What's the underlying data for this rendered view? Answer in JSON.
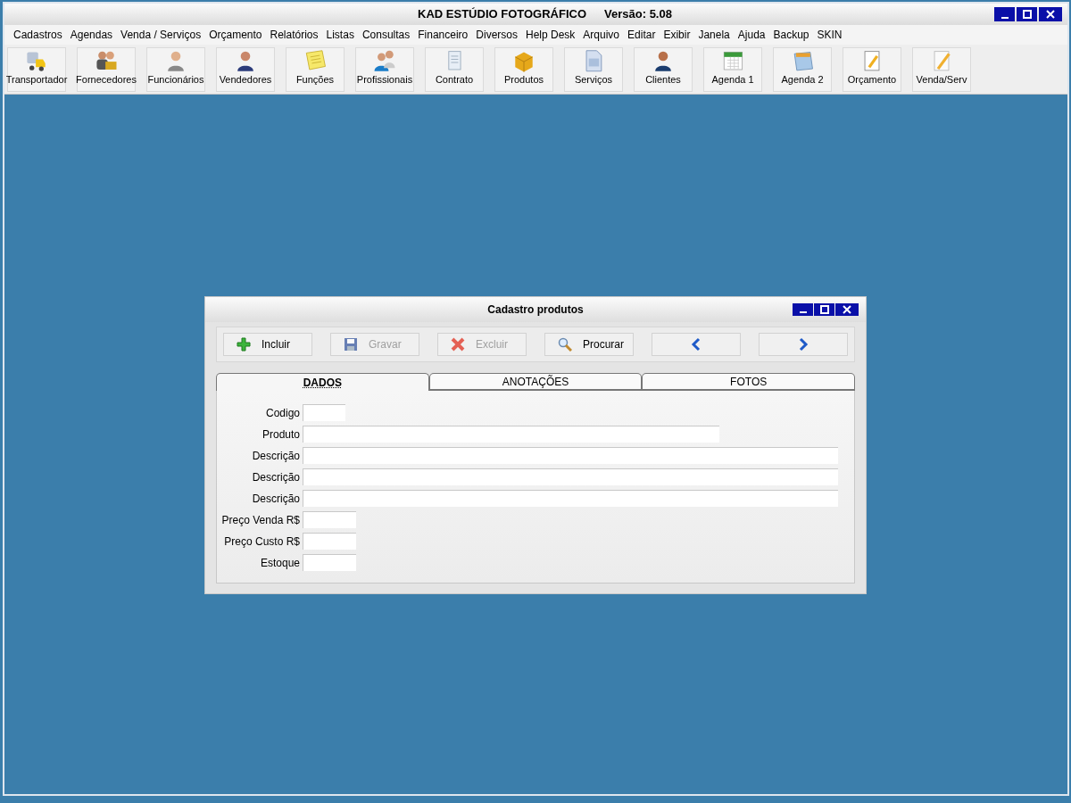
{
  "window": {
    "title": "KAD ESTÚDIO FOTOGRÁFICO",
    "version": "Versão: 5.08"
  },
  "menu": [
    "Cadastros",
    "Agendas",
    "Venda / Serviços",
    "Orçamento",
    "Relatórios",
    "Listas",
    "Consultas",
    "Financeiro",
    "Diversos",
    "Help Desk",
    "Arquivo",
    "Editar",
    "Exibir",
    "Janela",
    "Ajuda",
    "Backup",
    "SKIN"
  ],
  "toolbar": [
    "Transportador",
    "Fornecedores",
    "Funcionários",
    "Vendedores",
    "Funções",
    "Profissionais",
    "Contrato",
    "Produtos",
    "Serviços",
    "Clientes",
    "Agenda 1",
    "Agenda 2",
    "Orçamento",
    "Venda/Serv"
  ],
  "dialog": {
    "title": "Cadastro produtos",
    "actions": [
      {
        "kind": "add",
        "label": "Incluir",
        "disabled": false
      },
      {
        "kind": "save",
        "label": "Gravar",
        "disabled": true
      },
      {
        "kind": "delete",
        "label": "Excluir",
        "disabled": true
      },
      {
        "kind": "search",
        "label": "Procurar",
        "disabled": false
      },
      {
        "kind": "prev",
        "disabled": false
      },
      {
        "kind": "next",
        "disabled": false
      }
    ],
    "tabs": [
      {
        "label": "DADOS",
        "selected": true
      },
      {
        "label": "ANOTAÇÕES",
        "selected": false
      },
      {
        "label": "FOTOS",
        "selected": false
      }
    ],
    "fields": [
      {
        "label": "Codigo",
        "kind": "tiny"
      },
      {
        "label": "Produto",
        "kind": "medium"
      },
      {
        "label": "Descrição",
        "kind": "wide"
      },
      {
        "label": "Descrição",
        "kind": "wide"
      },
      {
        "label": "Descrição",
        "kind": "wide"
      },
      {
        "label": "Preço Venda R$",
        "kind": "short"
      },
      {
        "label": "Preço Custo R$",
        "kind": "short"
      },
      {
        "label": "Estoque",
        "kind": "short"
      }
    ]
  }
}
